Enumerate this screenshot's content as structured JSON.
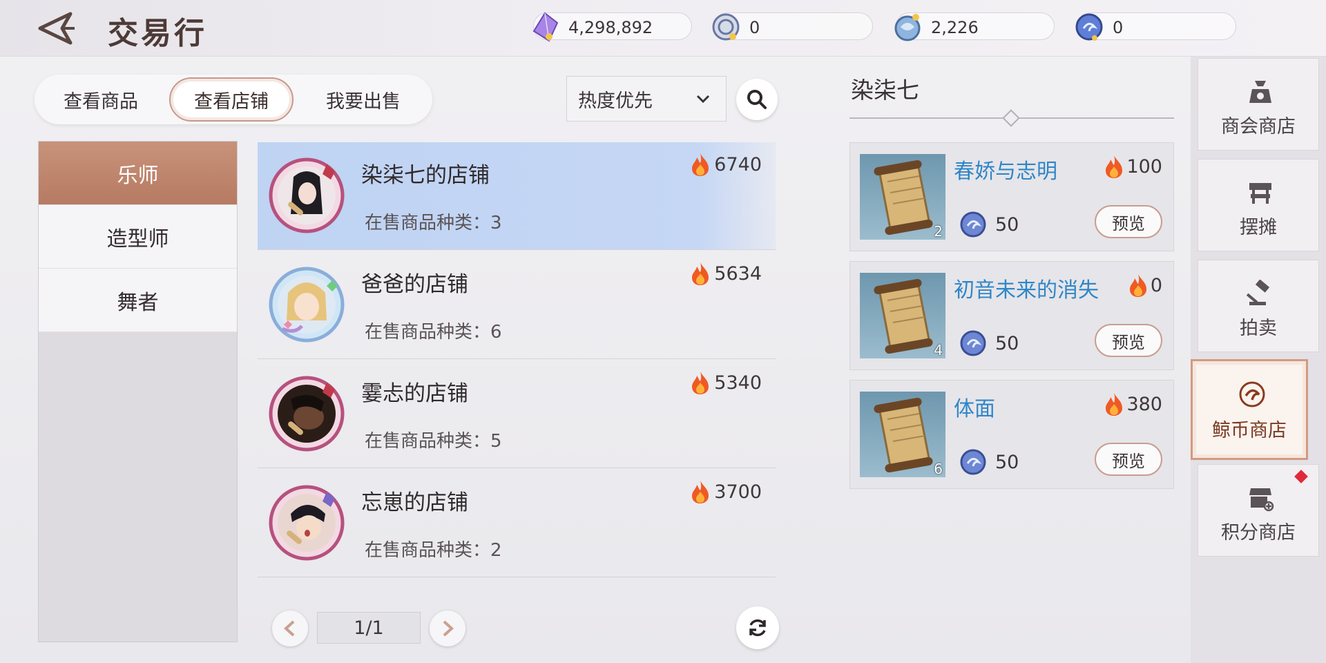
{
  "header": {
    "title": "交易行",
    "currencies": [
      {
        "icon": "purple-crystal-icon",
        "value": "4,298,892"
      },
      {
        "icon": "silver-coin-icon",
        "value": "0"
      },
      {
        "icon": "dragon-coin-icon",
        "value": "2,226"
      },
      {
        "icon": "whale-coin-icon",
        "value": "0"
      }
    ]
  },
  "tabs": [
    {
      "label": "查看商品",
      "active": false
    },
    {
      "label": "查看店铺",
      "active": true
    },
    {
      "label": "我要出售",
      "active": false
    }
  ],
  "sort": {
    "selected": "热度优先"
  },
  "categories": [
    {
      "label": "乐师",
      "active": true
    },
    {
      "label": "造型师",
      "active": false
    },
    {
      "label": "舞者",
      "active": false
    }
  ],
  "shops": [
    {
      "name": "染柒七的店铺",
      "count_label": "在售商品种类：3",
      "heat": "6740",
      "selected": true,
      "avatar": "musician"
    },
    {
      "name": "爸爸的店铺",
      "count_label": "在售商品种类：6",
      "heat": "5634",
      "selected": false,
      "avatar": "blonde-girl"
    },
    {
      "name": "霎忐的店铺",
      "count_label": "在售商品种类：5",
      "heat": "5340",
      "selected": false,
      "avatar": "dark"
    },
    {
      "name": "忘崽的店铺",
      "count_label": "在售商品种类：2",
      "heat": "3700",
      "selected": false,
      "avatar": "boy"
    }
  ],
  "pager": {
    "label": "1/1"
  },
  "owner": {
    "name": "染柒七"
  },
  "items": [
    {
      "name": "春娇与志明",
      "heat": "100",
      "qty": "2",
      "price": "50",
      "button": "预览"
    },
    {
      "name": "初音未来的消失",
      "heat": "0",
      "qty": "4",
      "price": "50",
      "button": "预览"
    },
    {
      "name": "体面",
      "heat": "380",
      "qty": "6",
      "price": "50",
      "button": "预览"
    }
  ],
  "side_nav": [
    {
      "label": "商会商店",
      "icon": "merchant-bag-icon",
      "active": false
    },
    {
      "label": "摆摊",
      "icon": "stall-icon",
      "active": false
    },
    {
      "label": "拍卖",
      "icon": "gavel-icon",
      "active": false
    },
    {
      "label": "鲸币商店",
      "icon": "whale-coin-icon",
      "active": true
    },
    {
      "label": "积分商店",
      "icon": "points-shop-icon",
      "active": false,
      "badge": true
    }
  ],
  "colors": {
    "accent": "#b67b62",
    "selected_row": "#c2d5f3",
    "item_name": "#2f86c8",
    "badge": "#e02a3b"
  }
}
